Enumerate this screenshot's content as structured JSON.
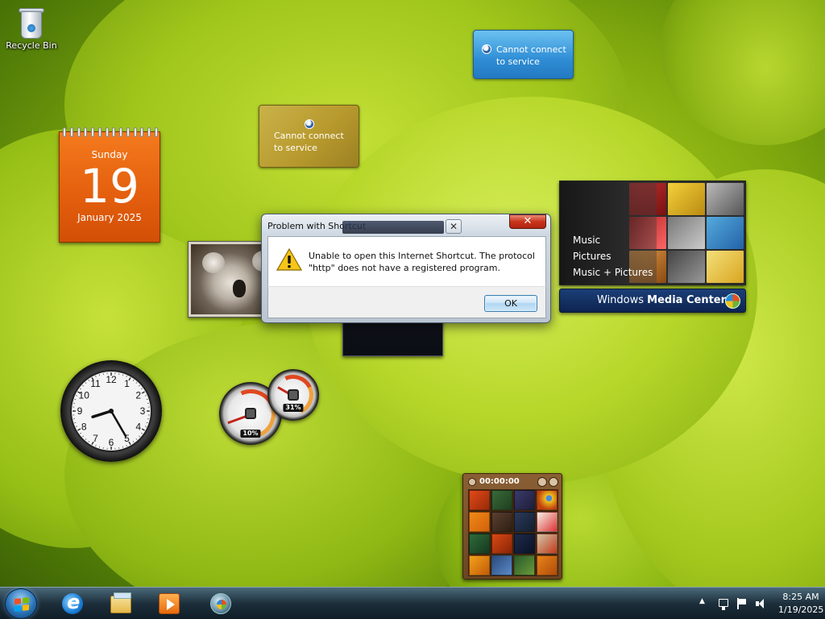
{
  "desktop": {
    "recycle_bin_label": "Recycle Bin"
  },
  "gadgets": {
    "weather": {
      "message": "Cannot connect to service"
    },
    "currency": {
      "message": "Cannot connect to service"
    },
    "calendar": {
      "weekday": "Sunday",
      "day": "19",
      "month_year": "January 2025"
    },
    "media_center": {
      "menu": [
        "Music",
        "Pictures",
        "Music + Pictures"
      ],
      "brand_light": "Windows",
      "brand_bold": "Media Center"
    },
    "clock": {
      "numerals": [
        "12",
        "1",
        "2",
        "3",
        "4",
        "5",
        "6",
        "7",
        "8",
        "9",
        "10",
        "11"
      ],
      "time": "8:25"
    },
    "cpu_meter": {
      "cpu_percent": "10%",
      "memory_percent": "31%"
    },
    "puzzle": {
      "timer": "00:00:00"
    }
  },
  "dialog": {
    "title": "Problem with Shortcut",
    "close_glyph": "✕",
    "message": "Unable to open this Internet Shortcut. The protocol \"http\" does not have a registered program.",
    "ok_label": "OK",
    "icon": "warning-icon"
  },
  "taskbar": {
    "apps": [
      {
        "name": "internet-explorer",
        "icon": "ie-icon"
      },
      {
        "name": "windows-explorer",
        "icon": "folder-icon"
      },
      {
        "name": "windows-media-player",
        "icon": "media-player-icon"
      },
      {
        "name": "windows-media-center",
        "icon": "media-center-icon"
      }
    ],
    "tray": {
      "show_hidden_glyph": "▲",
      "time": "8:25 AM",
      "date": "1/19/2025"
    }
  },
  "colors": {
    "calendar_orange": "#e35e0d",
    "dialog_close_red": "#c8341b",
    "weather_blue": "#2f8ed5",
    "currency_gold": "#b89a2e",
    "media_center_blue": "#1b3f78"
  }
}
